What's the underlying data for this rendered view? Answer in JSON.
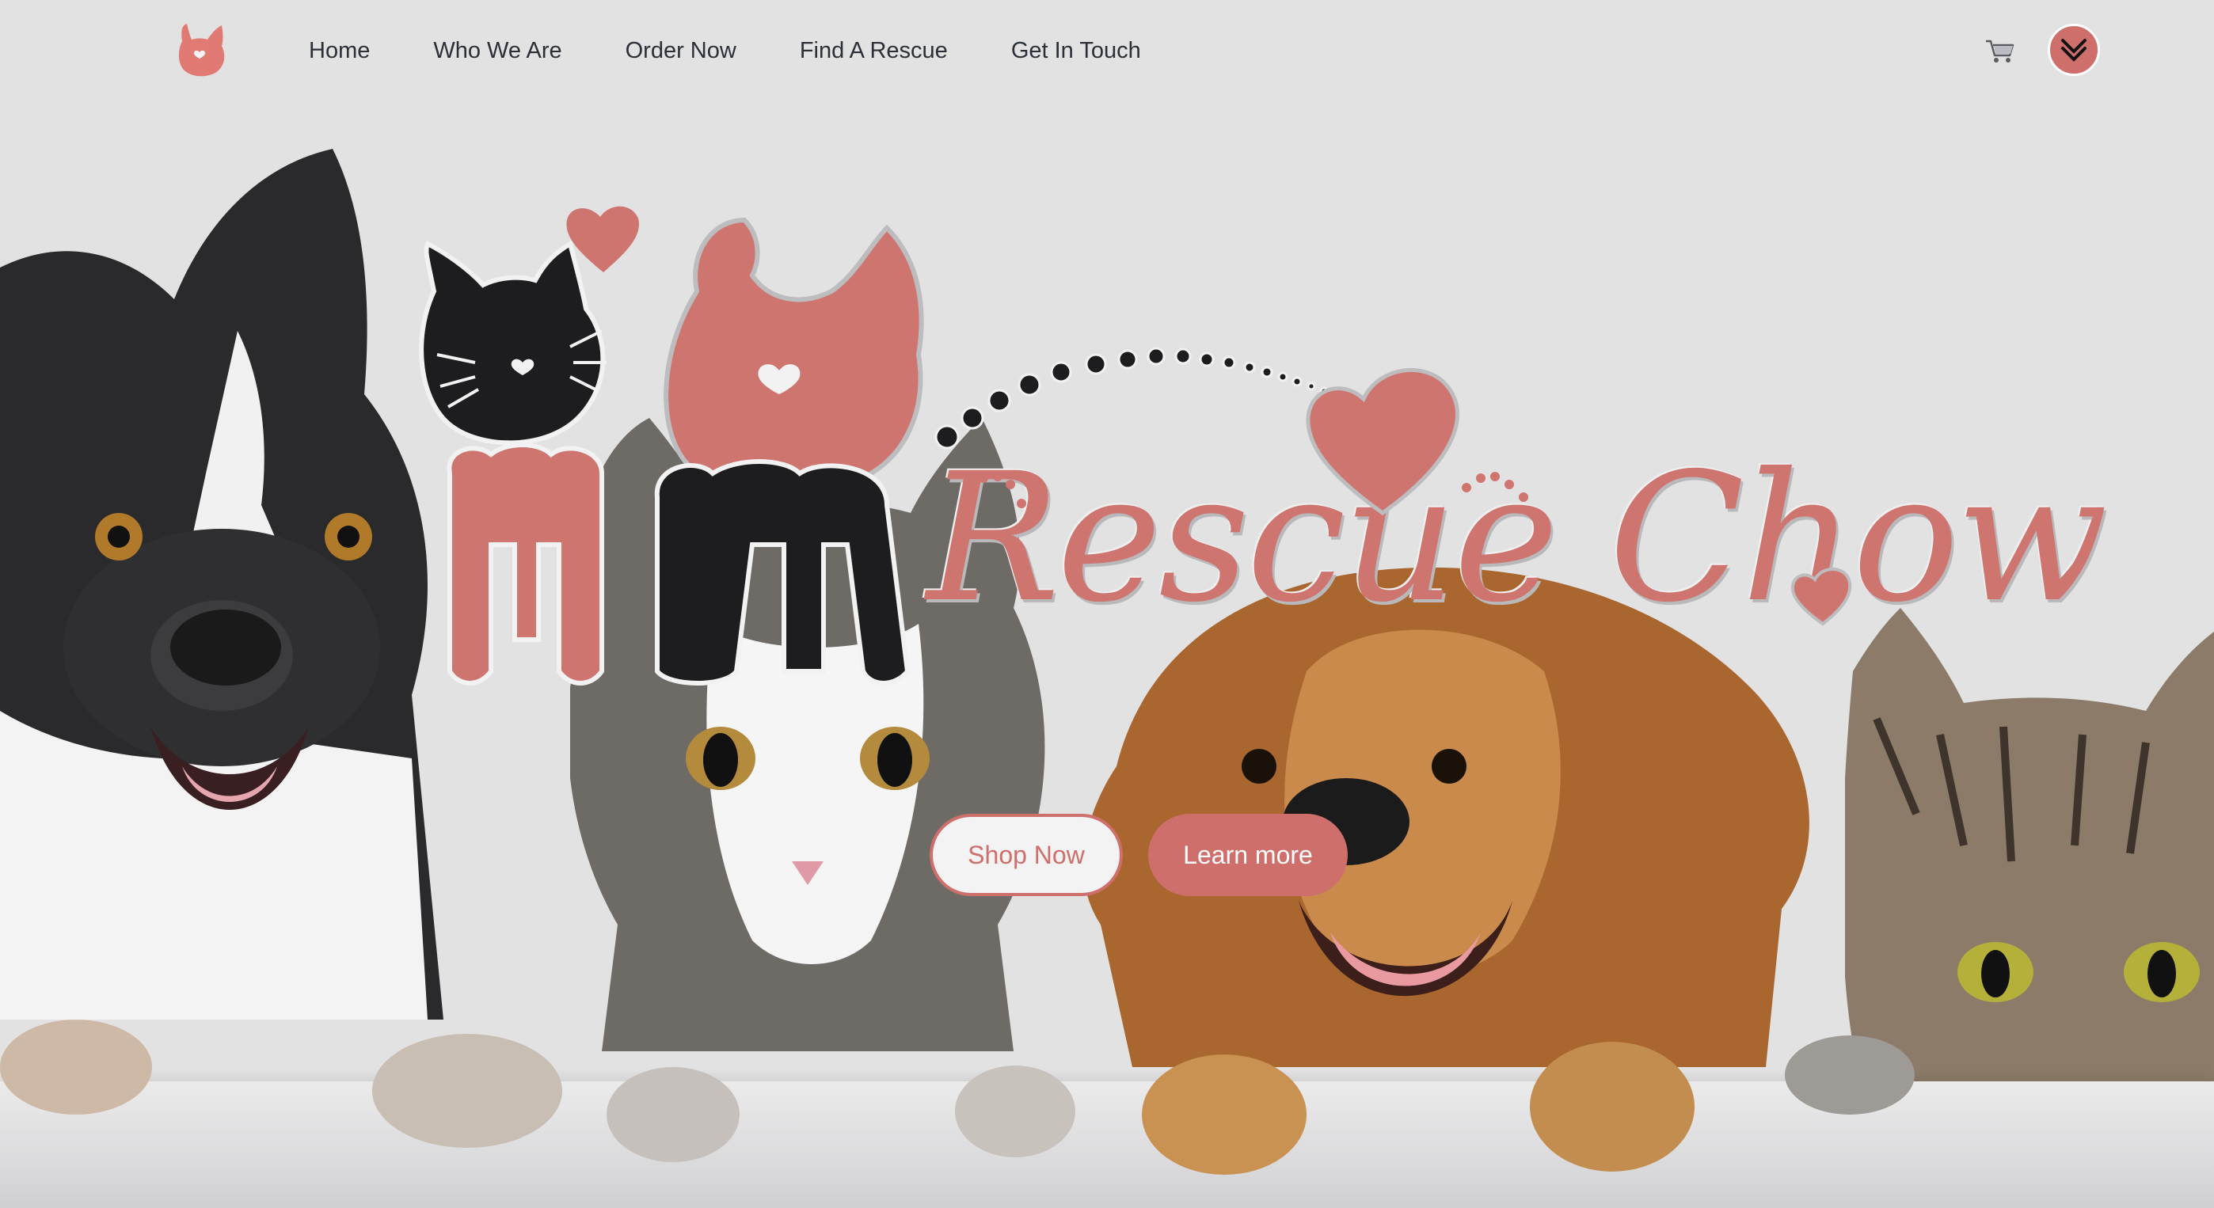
{
  "nav": {
    "links": [
      "Home",
      "Who We Are",
      "Order Now",
      "Find A Rescue",
      "Get In Touch"
    ]
  },
  "brand": {
    "name": "Rescue Chow"
  },
  "hero": {
    "shop_label": "Shop Now",
    "learn_label": "Learn more"
  },
  "colors": {
    "accent": "#cf6f6b",
    "background": "#e2e2e3",
    "nav_text": "#2b2f38"
  },
  "icons": [
    "logo-icon",
    "cart-icon",
    "chevron-double-down-icon",
    "heart-icon"
  ]
}
